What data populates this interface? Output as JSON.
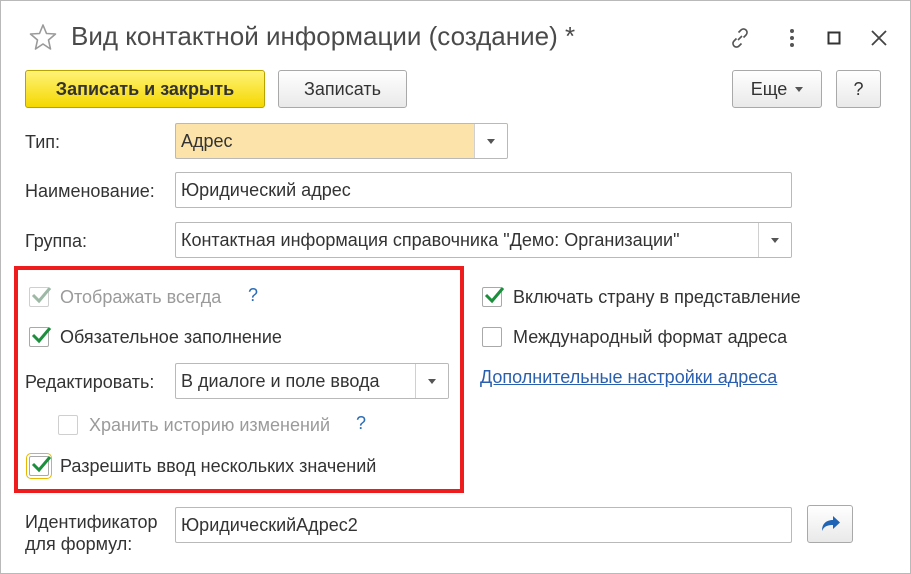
{
  "window": {
    "title": "Вид контактной информации (создание) *",
    "icons": [
      "star-icon",
      "link-icon",
      "more-icon",
      "maximize-icon",
      "close-icon"
    ]
  },
  "toolbar": {
    "save_close_label": "Записать и закрыть",
    "save_label": "Записать",
    "more_label": "Еще",
    "help_label": "?"
  },
  "form": {
    "type_label": "Тип:",
    "type_value": "Адрес",
    "name_label": "Наименование:",
    "name_value": "Юридический адрес",
    "group_label": "Группа:",
    "group_value": "Контактная информация справочника \"Демо: Организации\"",
    "show_always": {
      "label": "Отображать всегда",
      "checked": true,
      "disabled": true,
      "help": "?"
    },
    "required": {
      "label": "Обязательное заполнение",
      "checked": true
    },
    "edit_label": "Редактировать:",
    "edit_value": "В диалоге и поле ввода",
    "history": {
      "label": "Хранить историю изменений",
      "checked": false,
      "disabled": true,
      "help": "?"
    },
    "multiple": {
      "label": "Разрешить ввод нескольких значений",
      "checked": true
    },
    "include_country": {
      "label": "Включать страну в представление",
      "checked": true
    },
    "intl_format": {
      "label": "Международный формат адреса",
      "checked": false
    },
    "advanced_link": "Дополнительные настройки адреса",
    "identifier_label_line1": "Идентификатор",
    "identifier_label_line2": "для формул:",
    "identifier_value": "ЮридическийАдрес2"
  },
  "colors": {
    "accent_yellow": "#f5d800",
    "highlight_red": "#ee1c1c",
    "check_green": "#1c8f3c",
    "link_blue": "#2a5fb0",
    "field_yellow": "#fbe3a9"
  }
}
